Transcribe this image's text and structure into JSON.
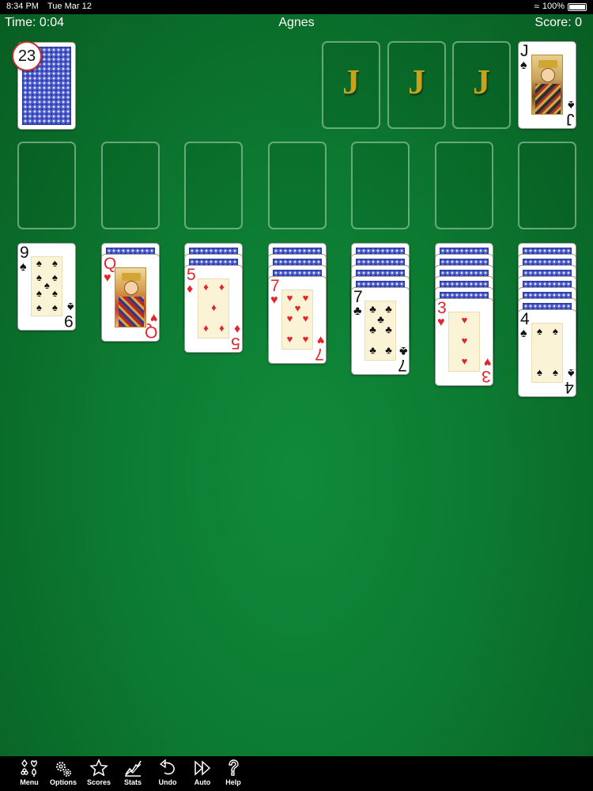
{
  "status_bar": {
    "time": "8:34 PM",
    "date": "Tue Mar 12",
    "battery": "100%",
    "battery_level": 1.0
  },
  "header": {
    "time": "Time: 0:04",
    "title": "Agnes",
    "score": "Score: 0"
  },
  "stock": {
    "count": "23"
  },
  "foundations": [
    {
      "mark": "J"
    },
    {
      "mark": "J"
    },
    {
      "mark": "J"
    },
    {
      "card": {
        "rank": "J",
        "suit": "♠",
        "color": "black"
      }
    }
  ],
  "tableau": [
    {
      "face_down": 0,
      "card": {
        "rank": "9",
        "suit": "♠",
        "color": "black"
      }
    },
    {
      "face_down": 1,
      "card": {
        "rank": "Q",
        "suit": "♥",
        "color": "red"
      }
    },
    {
      "face_down": 2,
      "card": {
        "rank": "5",
        "suit": "♦",
        "color": "red"
      }
    },
    {
      "face_down": 3,
      "card": {
        "rank": "7",
        "suit": "♥",
        "color": "red"
      }
    },
    {
      "face_down": 4,
      "card": {
        "rank": "7",
        "suit": "♣",
        "color": "black"
      }
    },
    {
      "face_down": 5,
      "card": {
        "rank": "3",
        "suit": "♥",
        "color": "red"
      }
    },
    {
      "face_down": 6,
      "card": {
        "rank": "4",
        "suit": "♠",
        "color": "black"
      }
    }
  ],
  "toolbar": [
    {
      "label": "Menu",
      "icon": "card-suits-icon"
    },
    {
      "label": "Options",
      "icon": "gears-icon"
    },
    {
      "label": "Scores",
      "icon": "star-icon"
    },
    {
      "label": "Stats",
      "icon": "chart-line-icon"
    },
    {
      "label": "Undo",
      "icon": "undo-arrow-icon"
    },
    {
      "label": "Auto",
      "icon": "fast-forward-icon"
    },
    {
      "label": "Help",
      "icon": "question-mark-icon"
    }
  ]
}
